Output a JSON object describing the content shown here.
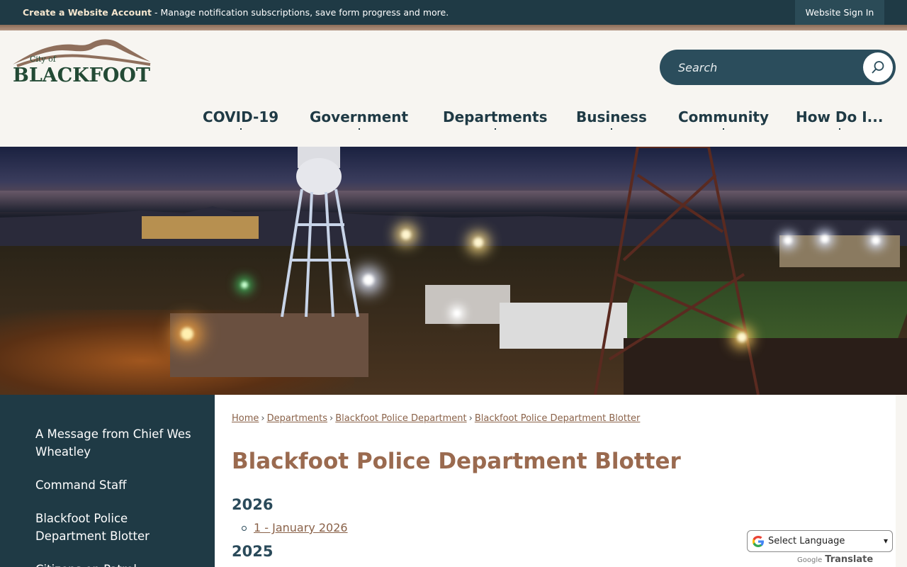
{
  "topbar": {
    "create_account_link": "Create a Website Account",
    "message": " - Manage notification subscriptions, save form progress and more.",
    "sign_in": "Website Sign In"
  },
  "logo": {
    "city_of": "City of",
    "name": "BLACKFOOT"
  },
  "search": {
    "placeholder": "Search",
    "icon": "search-icon"
  },
  "nav": {
    "items": [
      {
        "label": "COVID-19"
      },
      {
        "label": "Government"
      },
      {
        "label": "Departments"
      },
      {
        "label": "Business"
      },
      {
        "label": "Community"
      },
      {
        "label": "How Do I..."
      }
    ]
  },
  "sidebar": {
    "items": [
      {
        "label": "A Message from Chief Wes Wheatley"
      },
      {
        "label": "Command Staff"
      },
      {
        "label": "Blackfoot Police Department Blotter"
      },
      {
        "label": "Citizens on Patrol"
      }
    ]
  },
  "breadcrumb": {
    "items": [
      "Home",
      "Departments",
      "Blackfoot Police Department",
      "Blackfoot Police Department Blotter"
    ],
    "separator": "›"
  },
  "main": {
    "title": "Blackfoot Police Department Blotter",
    "years": [
      {
        "year": "2026",
        "links": [
          "1 - January 2026"
        ]
      },
      {
        "year": "2025",
        "links": []
      }
    ]
  },
  "translate": {
    "select_label": "Select Language",
    "powered_by": "Google",
    "translate_word": "Translate"
  },
  "colors": {
    "dark_teal": "#1f3a45",
    "accent_brown": "#9a6a4f",
    "link_brown": "#8a6249"
  }
}
